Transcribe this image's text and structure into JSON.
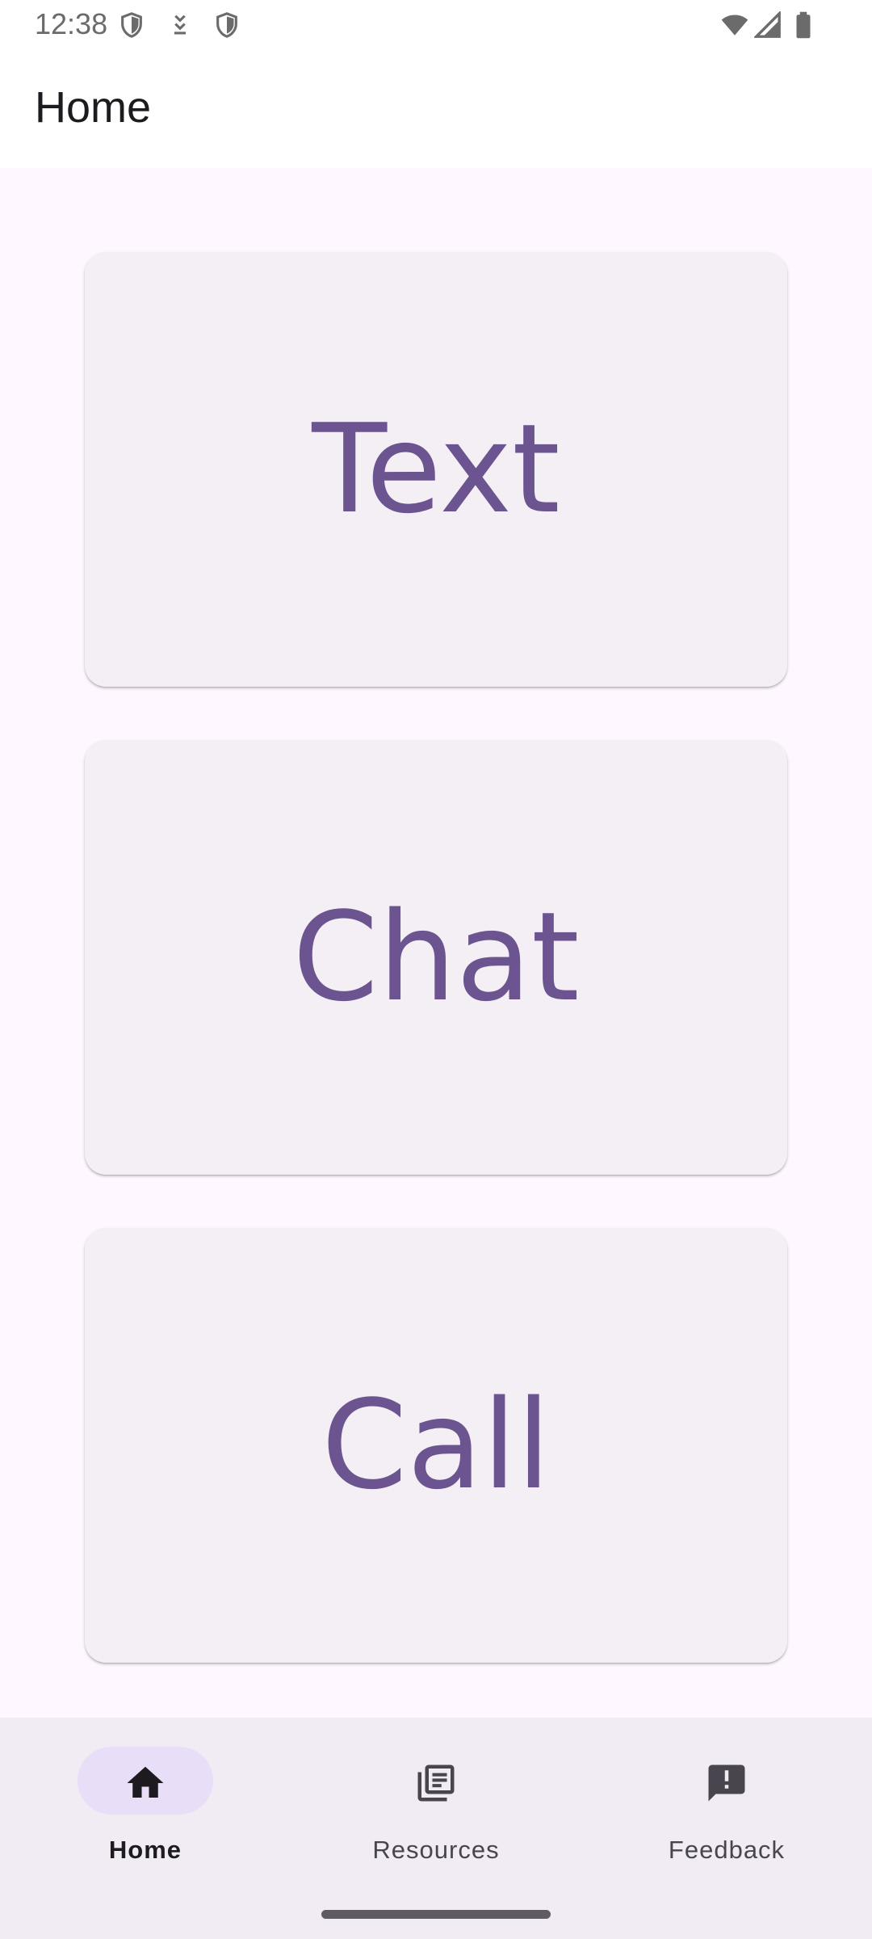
{
  "status_bar": {
    "time": "12:38",
    "left_icons": [
      "shield-icon",
      "download-icon",
      "shield-icon"
    ],
    "right_icons": [
      "wifi-icon",
      "cellular-signal-icon",
      "battery-icon"
    ]
  },
  "app_bar": {
    "title": "Home"
  },
  "cards": [
    {
      "label": "Text"
    },
    {
      "label": "Chat"
    },
    {
      "label": "Call"
    }
  ],
  "bottom_nav": {
    "items": [
      {
        "label": "Home",
        "icon": "home-icon",
        "active": true
      },
      {
        "label": "Resources",
        "icon": "library-books-icon",
        "active": false
      },
      {
        "label": "Feedback",
        "icon": "feedback-icon",
        "active": false
      }
    ]
  },
  "colors": {
    "accent": "#6b5490",
    "card_background": "#f4eff5",
    "content_background": "#fef7ff",
    "nav_background": "#f1ecf3",
    "active_indicator": "#e8def8"
  }
}
